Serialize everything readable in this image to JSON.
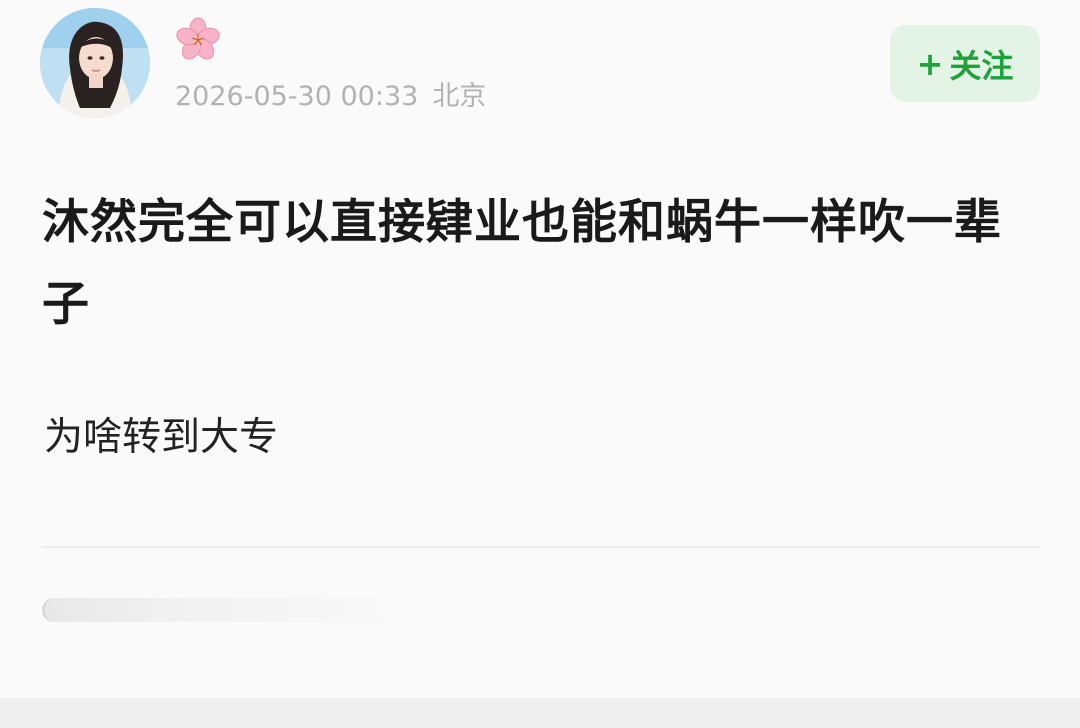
{
  "author": {
    "avatar": "avatar-photo",
    "nickname_icon": "cherry-blossom-icon"
  },
  "meta": {
    "timestamp": "2026-05-30 00:33",
    "location": "北京"
  },
  "follow_button": {
    "plus": "+",
    "label": "关注",
    "color": "#20a23a",
    "background": "#e3f4e6"
  },
  "post": {
    "title": "沐然完全可以直接肄业也能和蜗牛一样吹一辈子",
    "body": "为啥转到大专"
  }
}
